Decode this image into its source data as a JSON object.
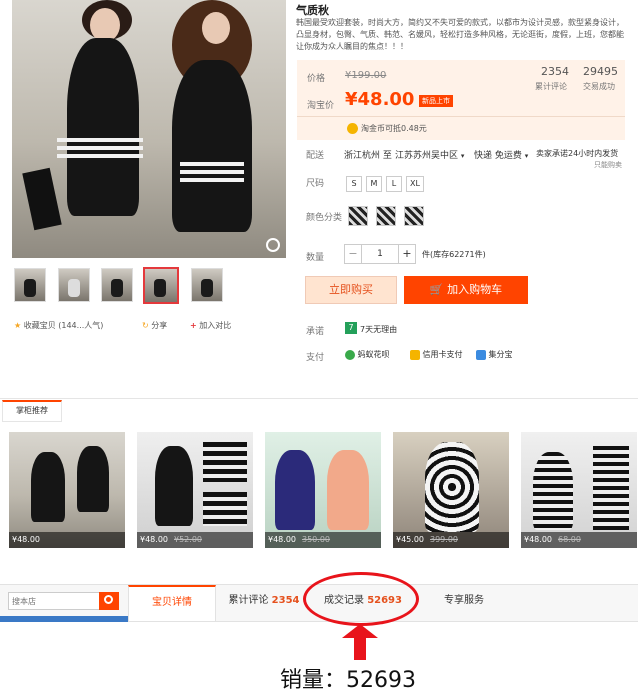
{
  "product": {
    "title": "气质秋",
    "desc": "韩国最受欢迎套装，时尚大方，简约又不失可爱的款式，以都市为设计灵感，款型紧身设计，凸显身材，包臀、气质、韩范、名媛风，轻松打造多种风格，无论逛街，度假，上班，您都能让你成为众人瞩目的焦点！！！",
    "price_label": "价格",
    "price_original": "¥199.00",
    "promo_label": "淘宝价",
    "price_current": "¥48.00",
    "promo_badge": "新品上市",
    "reviews_count": "2354",
    "reviews_label": "累计评论",
    "sales_count": "29495",
    "sales_label": "交易成功",
    "coin_text": "淘金币可抵0.48元",
    "delivery_label": "配送",
    "delivery_from": "浙江杭州 至",
    "delivery_to": "江苏苏州吴中区",
    "delivery_shipping": "快递 免运费",
    "delivery_promise": "卖家承诺24小时内发货",
    "delivery_sub": "只能购卖",
    "size_label": "尺码",
    "sizes": [
      "S",
      "M",
      "L",
      "XL"
    ],
    "color_label": "颜色分类",
    "qty_label": "数量",
    "qty_minus": "−",
    "qty_value": "1",
    "qty_plus": "+",
    "stock_text": "件(库存62271件)",
    "buy_now": "立即购买",
    "add_cart": "加入购物车",
    "promise_label": "承诺",
    "promise_badge": "7",
    "promise_text": "7天无理由",
    "pay_label": "支付",
    "pay_methods": [
      "蚂蚁花呗",
      "信用卡支付",
      "集分宝"
    ]
  },
  "actions": {
    "favorite": "收藏宝贝 (144...人气)",
    "share": "分享",
    "compare": "加入对比"
  },
  "recommend": {
    "title": "掌柜推荐",
    "items": [
      {
        "price": "¥48.00",
        "old": ""
      },
      {
        "price": "¥48.00",
        "old": "¥52.00"
      },
      {
        "price": "¥48.00",
        "old": "350.00"
      },
      {
        "price": "¥45.00",
        "old": "399.00"
      },
      {
        "price": "¥48.00",
        "old": "68.00"
      }
    ]
  },
  "tabs": {
    "search_placeholder": "搜本店",
    "detail": "宝贝详情",
    "reviews_label": "累计评论",
    "reviews_count": "2354",
    "records_label": "成交记录",
    "records_count": "52693",
    "service": "专享服务"
  },
  "annotation": {
    "text": "销量：52693"
  },
  "colors": {
    "accent": "#ff4400",
    "price": "#ff4400",
    "annotation_red": "#e8141b"
  }
}
